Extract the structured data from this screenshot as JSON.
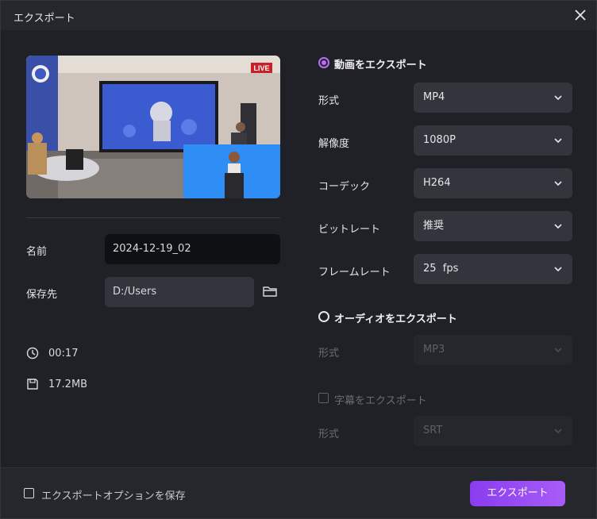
{
  "window": {
    "title": "エクスポート"
  },
  "preview": {
    "live_badge": "LIVE"
  },
  "file": {
    "name_label": "名前",
    "name_value": "2024-12-19_02",
    "save_label": "保存先",
    "save_value": "D:/Users",
    "duration": "00:17",
    "size": "17.2MB"
  },
  "video": {
    "title": "動画をエクスポート",
    "selected": true,
    "format_label": "形式",
    "format_value": "MP4",
    "resolution_label": "解像度",
    "resolution_value": "1080P",
    "codec_label": "コーデック",
    "codec_value": "H264",
    "bitrate_label": "ビットレート",
    "bitrate_value": "推奨",
    "framerate_label": "フレームレート",
    "framerate_value": "25  fps"
  },
  "audio": {
    "title": "オーディオをエクスポート",
    "selected": false,
    "format_label": "形式",
    "format_value": "MP3"
  },
  "subtitle": {
    "title": "字幕をエクスポート",
    "checked": false,
    "format_label": "形式",
    "format_value": "SRT"
  },
  "footer": {
    "save_options_label": "エクスポートオプションを保存",
    "export_label": "エクスポート"
  },
  "colors": {
    "accent": "#b96cf6",
    "button_start": "#8a3cf0",
    "button_end": "#a85cf7"
  }
}
